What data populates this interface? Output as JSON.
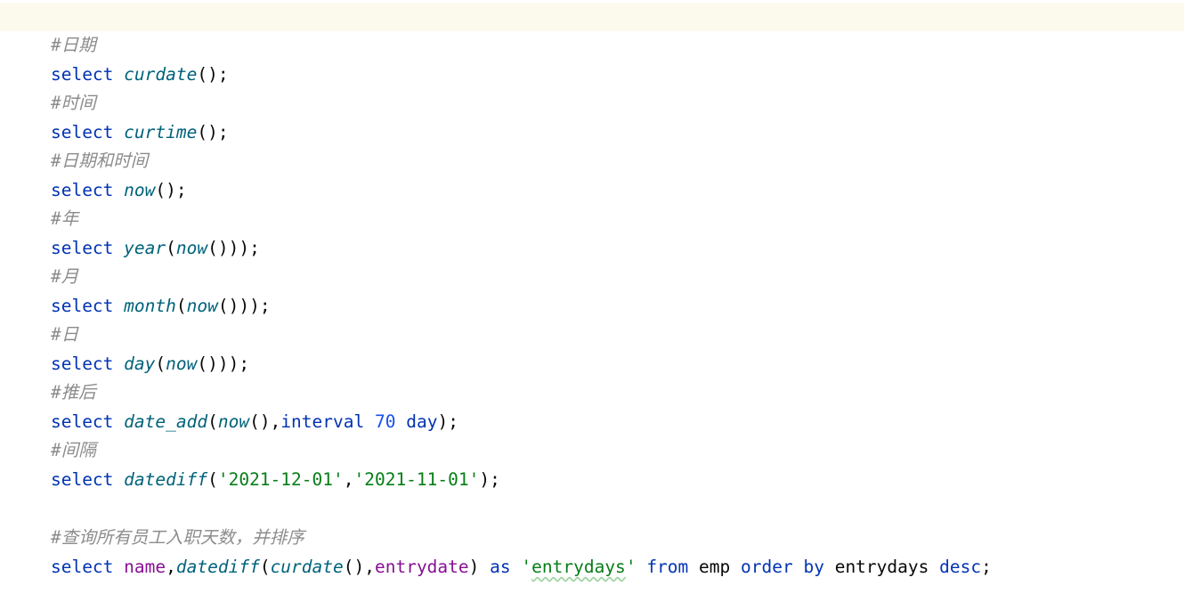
{
  "editor": {
    "kw": {
      "select": "select",
      "interval": "interval",
      "day": "day",
      "as": "as",
      "from": "from",
      "order": "order",
      "by": "by",
      "desc": "desc"
    },
    "p": {
      "semi": ");",
      "open_close_semi": "();",
      "open": "(",
      "open_close": "()",
      "close_semi": "));",
      "comma": ",",
      "close": ")",
      "space": " ",
      "semicolon": ";",
      "open_close_comma": "(),"
    },
    "lines": {
      "c1": "#日期",
      "f_curdate": "curdate",
      "c2": "#时间",
      "f_curtime": "curtime",
      "c3": "#日期和时间",
      "f_now": "now",
      "c4": "#年",
      "f_year": "year",
      "c5": "#月",
      "f_month": "month",
      "c6": "#日",
      "f_day": "day",
      "c7": "#推后",
      "f_date_add": "date_add",
      "num70": "70",
      "c8": "#间隔",
      "f_datediff": "datediff",
      "s1": "'2021-12-01'",
      "s2": "'2021-11-01'",
      "c9": "#查询所有员工入职天数，并排序",
      "id_name": "name",
      "id_entrydate": "entrydate",
      "s_q1": "'",
      "s_entrydays": "entrydays",
      "s_q2": "'",
      "t_emp": "emp",
      "t_entrydays": "entrydays"
    }
  }
}
